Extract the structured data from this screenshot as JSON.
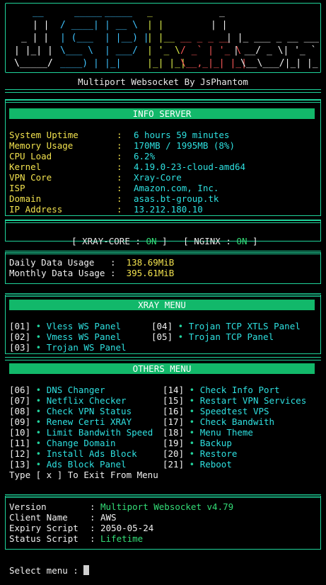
{
  "banner": {
    "logo_text": "JsPhantom",
    "subtitle": "Multiport Websocket By JsPhantom"
  },
  "info_server": {
    "header": "INFO SERVER",
    "rows": [
      {
        "label": "System Uptime",
        "value": "6 hours 59 minutes"
      },
      {
        "label": "Memory Usage",
        "value": "170MB / 1995MB (8%)"
      },
      {
        "label": "CPU Load",
        "value": "6.2%"
      },
      {
        "label": "Kernel",
        "value": "4.19.0-23-cloud-amd64"
      },
      {
        "label": "VPN Core",
        "value": "Xray-Core"
      },
      {
        "label": "ISP",
        "value": "Amazon.com, Inc."
      },
      {
        "label": "Domain",
        "value": "asas.bt-group.tk"
      },
      {
        "label": "IP Address",
        "value": "13.212.180.10"
      }
    ],
    "separator": ":"
  },
  "status": {
    "xray_label": "XRAY-CORE :",
    "xray_value": "ON",
    "nginx_label": "NGINX :",
    "nginx_value": "ON"
  },
  "usage": {
    "daily_label": "Daily Data Usage",
    "daily_value": "138.69MiB",
    "monthly_label": "Monthly Data Usage",
    "monthly_value": "395.61MiB",
    "separator": ":"
  },
  "xray_menu": {
    "header": "XRAY MENU",
    "left": [
      {
        "num": "[01]",
        "label": "Vless WS Panel"
      },
      {
        "num": "[02]",
        "label": "Vmess WS Panel"
      },
      {
        "num": "[03]",
        "label": "Trojan WS Panel"
      }
    ],
    "right": [
      {
        "num": "[04]",
        "label": "Trojan TCP XTLS Panel"
      },
      {
        "num": "[05]",
        "label": "Trojan TCP Panel"
      }
    ]
  },
  "others_menu": {
    "header": "OTHERS MENU",
    "left": [
      {
        "num": "[06]",
        "label": "DNS Changer"
      },
      {
        "num": "[07]",
        "label": "Netflix Checker"
      },
      {
        "num": "[08]",
        "label": "Check VPN Status"
      },
      {
        "num": "[09]",
        "label": "Renew Certi XRAY"
      },
      {
        "num": "[10]",
        "label": "Limit Bandwith Speed"
      },
      {
        "num": "[11]",
        "label": "Change Domain"
      },
      {
        "num": "[12]",
        "label": "Install Ads Block"
      },
      {
        "num": "[13]",
        "label": "Ads Block Panel"
      }
    ],
    "right": [
      {
        "num": "[14]",
        "label": "Check Info Port"
      },
      {
        "num": "[15]",
        "label": "Restart VPN Services"
      },
      {
        "num": "[16]",
        "label": "Speedtest VPS"
      },
      {
        "num": "[17]",
        "label": "Check Bandwith"
      },
      {
        "num": "[18]",
        "label": "Menu Theme"
      },
      {
        "num": "[19]",
        "label": "Backup"
      },
      {
        "num": "[20]",
        "label": "Restore"
      },
      {
        "num": "[21]",
        "label": "Reboot"
      }
    ],
    "exit_hint": "Type [ x ] To Exit From Menu"
  },
  "script_info": {
    "rows": [
      {
        "label": "Version",
        "value": "Multiport Websocket v4.79",
        "color": "green"
      },
      {
        "label": "Client Name",
        "value": "AWS",
        "color": "white"
      },
      {
        "label": "Expiry Script",
        "value": "2050-05-24",
        "color": "white"
      },
      {
        "label": "Status Script",
        "value": "Lifetime",
        "color": "green"
      }
    ],
    "separator": ":"
  },
  "prompt": {
    "label": "Select menu :"
  },
  "colors": {
    "accent": "#1fd39a",
    "bar": "#12b86a",
    "label": "#f2e24e",
    "value": "#2ee0e0",
    "on": "#33dd77",
    "bullet": "#22d39d"
  },
  "icons": {
    "bullet": "•"
  }
}
